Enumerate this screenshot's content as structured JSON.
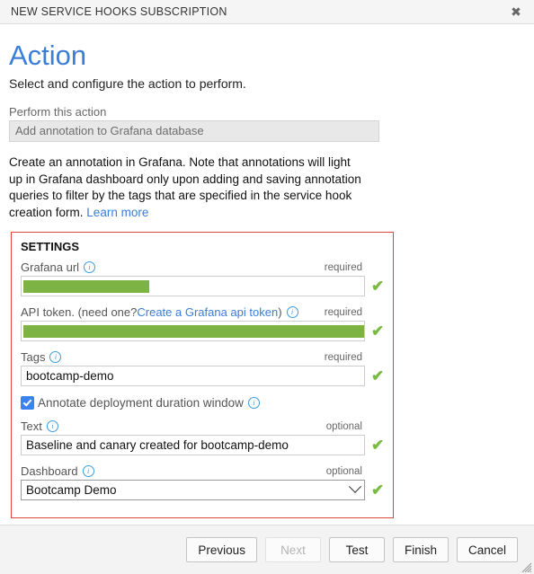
{
  "window": {
    "title": "NEW SERVICE HOOKS SUBSCRIPTION",
    "close_label": "✖"
  },
  "page": {
    "heading": "Action",
    "subtitle": "Select and configure the action to perform.",
    "action_field_label": "Perform this action",
    "action_value": "Add annotation to Grafana database",
    "description": "Create an annotation in Grafana. Note that annotations will light up in Grafana dashboard only upon adding and saving annotation queries to filter by the tags that are specified in the service hook creation form.",
    "description_link": "Learn more"
  },
  "settings": {
    "heading": "SETTINGS",
    "accent_color": "#d9463c",
    "valid_color": "#79bb3f",
    "redaction_color": "#7cb342",
    "fields": [
      {
        "label": "Grafana url",
        "requirement": "required",
        "value": "",
        "redacted": true,
        "valid": true,
        "type": "text"
      },
      {
        "label_prefix": "API token. (need one? ",
        "label_link": "Create a Grafana api token",
        "label_suffix": ")",
        "requirement": "required",
        "value": "",
        "redacted": true,
        "valid": true,
        "type": "text"
      },
      {
        "label": "Tags",
        "requirement": "required",
        "value": "bootcamp-demo",
        "redacted": false,
        "valid": true,
        "type": "text"
      },
      {
        "label": "Text",
        "requirement": "optional",
        "value": "Baseline and canary created for bootcamp-demo",
        "redacted": false,
        "valid": true,
        "type": "text"
      },
      {
        "label": "Dashboard",
        "requirement": "optional",
        "value": "Bootcamp Demo",
        "redacted": false,
        "valid": true,
        "type": "select"
      }
    ],
    "checkbox": {
      "label": "Annotate deployment duration window",
      "checked": true
    },
    "info_glyph": "i",
    "valid_glyph": "✔"
  },
  "footer": {
    "buttons": [
      {
        "label": "Previous",
        "disabled": false
      },
      {
        "label": "Next",
        "disabled": true
      },
      {
        "label": "Test",
        "disabled": false
      },
      {
        "label": "Finish",
        "disabled": false
      },
      {
        "label": "Cancel",
        "disabled": false
      }
    ]
  }
}
